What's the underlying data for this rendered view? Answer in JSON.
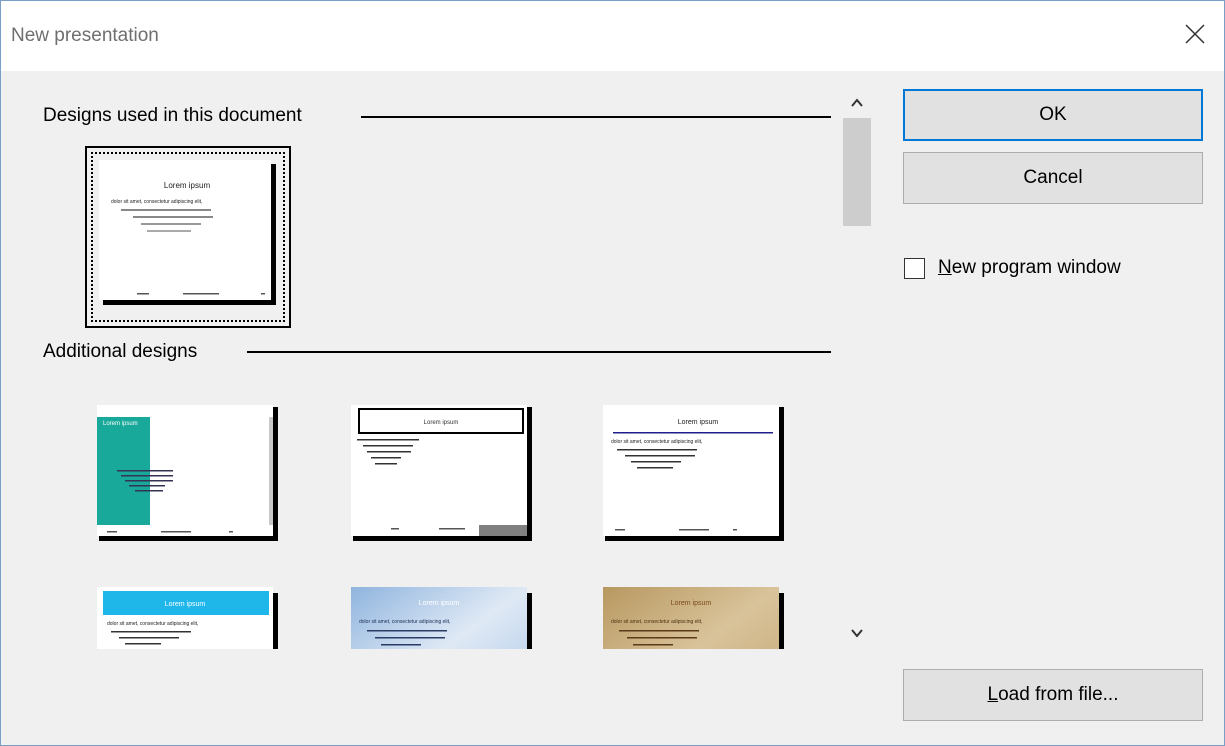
{
  "dialog": {
    "title": "New presentation",
    "close_icon": "close-icon"
  },
  "sections": {
    "used": "Designs used in this document",
    "additional": "Additional designs"
  },
  "thumbnail_text": {
    "title": "Lorem ipsum",
    "body": "dolor sit amet, consectetur adipiscing elit,"
  },
  "buttons": {
    "ok": "OK",
    "cancel": "Cancel",
    "load_prefix": "L",
    "load_rest": "oad from file..."
  },
  "options": {
    "new_window": {
      "label": "New program window",
      "checked": false
    }
  },
  "colors": {
    "accent": "#0078d7",
    "teal": "#19a99b",
    "cyan": "#1fb7ea",
    "navy": "#1f1f8c",
    "sky": "#9fc2e7",
    "sand": "#c9a978"
  },
  "scroll_icons": {
    "up": "chevron-up-icon",
    "down": "chevron-down-icon"
  }
}
